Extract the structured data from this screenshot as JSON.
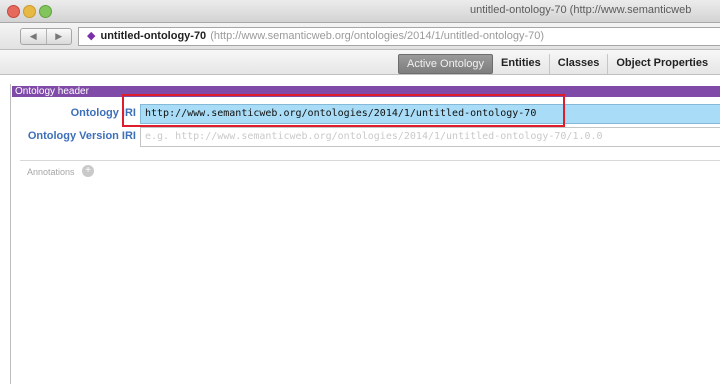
{
  "window": {
    "title": "untitled-ontology-70 (http://www.semanticweb"
  },
  "navigation": {
    "back_icon": "back-arrow-icon",
    "forward_icon": "forward-arrow-icon",
    "address": {
      "icon": "ontology-diamond-icon",
      "name": "untitled-ontology-70",
      "uri": "(http://www.semanticweb.org/ontologies/2014/1/untitled-ontology-70)"
    }
  },
  "tabs": [
    {
      "label": "Active Ontology",
      "active": true
    },
    {
      "label": "Entities",
      "active": false
    },
    {
      "label": "Classes",
      "active": false
    },
    {
      "label": "Object Properties",
      "active": false
    }
  ],
  "ontology_header": {
    "title": "Ontology header",
    "iri_label": "Ontology IRI",
    "iri_value": "http://www.semanticweb.org/ontologies/2014/1/untitled-ontology-70",
    "version_iri_label": "Ontology Version IRI",
    "version_iri_placeholder": "e.g. http://www.semanticweb.org/ontologies/2014/1/untitled-ontology-70/1.0.0"
  },
  "annotations": {
    "label": "Annotations",
    "add_icon": "add-circle-icon"
  },
  "colors": {
    "header_band": "#7f4aa8",
    "iri_field_bg": "#a9dcf6",
    "highlight_box": "#dd1d2c",
    "label_blue": "#3d6fb8"
  }
}
